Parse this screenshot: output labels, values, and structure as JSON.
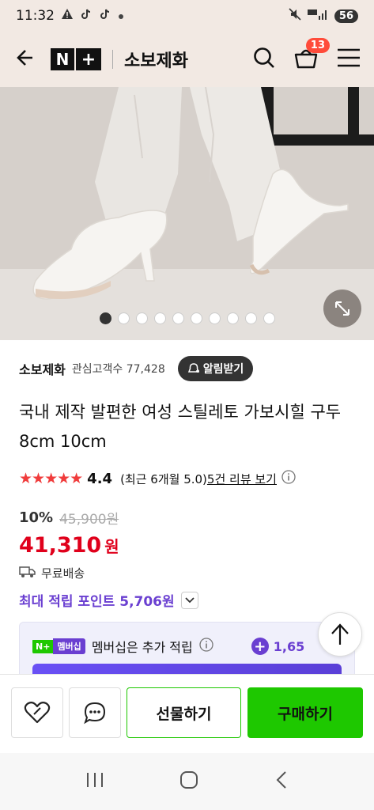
{
  "status_bar": {
    "time": "11:32",
    "battery": "56"
  },
  "header": {
    "logo_n": "N",
    "logo_plus": "+",
    "store_name": "소보제화",
    "cart_count": "13"
  },
  "hero": {
    "dot_count": 10,
    "active_dot": 0
  },
  "seller": {
    "name": "소보제화",
    "follower_label": "관심고객수 77,428",
    "alarm_label": "알림받기"
  },
  "product": {
    "title": "국내 제작 발편한 여성 스틸레토 가보시힐 구두 8cm 10cm",
    "stars": "★★★★★",
    "rating": "4.4",
    "rating_note": "(최근 6개월 5.0)",
    "review_link": "5건 리뷰 보기",
    "discount": "10%",
    "original_price": "45,900원",
    "price": "41,310",
    "price_unit": "원",
    "shipping": "무료배송",
    "max_point": "최대 적립 포인트 5,706원"
  },
  "membership": {
    "badge_np": "N+",
    "badge_ms": "멤버십",
    "label": "멤버십은 추가 적립",
    "point": "1,65"
  },
  "bottom": {
    "gift_label": "선물하기",
    "buy_label": "구매하기"
  },
  "colors": {
    "header_bg": "#f2e9e3",
    "accent_green": "#1ec800",
    "price_red": "#e0001b",
    "point_purple": "#6a3fd1"
  }
}
